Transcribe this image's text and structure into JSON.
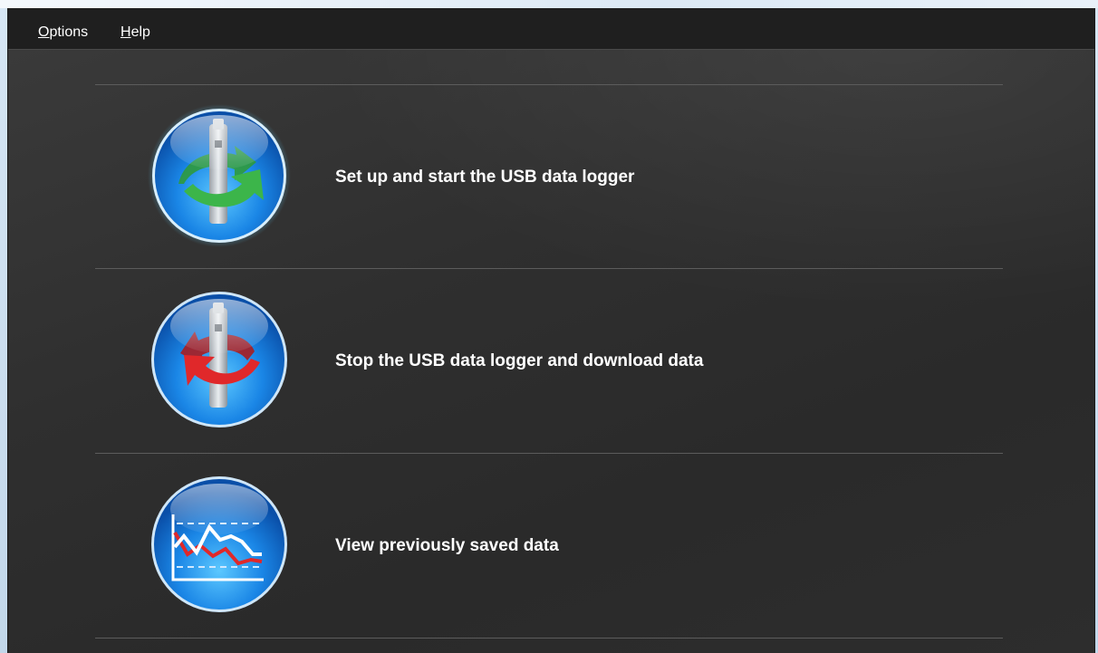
{
  "menu": {
    "options_label": "Options",
    "help_label": "Help"
  },
  "actions": [
    {
      "label": "Set up and start the USB data logger",
      "icon": "usb-logger-start-icon",
      "arrow_color": "#3cb54a"
    },
    {
      "label": "Stop the USB data logger and download data",
      "icon": "usb-logger-stop-icon",
      "arrow_color": "#e0282a"
    },
    {
      "label": "View previously saved data",
      "icon": "graph-view-icon",
      "line_colors": [
        "#ffffff",
        "#e0282a"
      ]
    }
  ],
  "colors": {
    "menubar": "#1f1f1f",
    "background": "#2f2f2f",
    "orb_blue": "#1a86e6",
    "text": "#ffffff"
  }
}
